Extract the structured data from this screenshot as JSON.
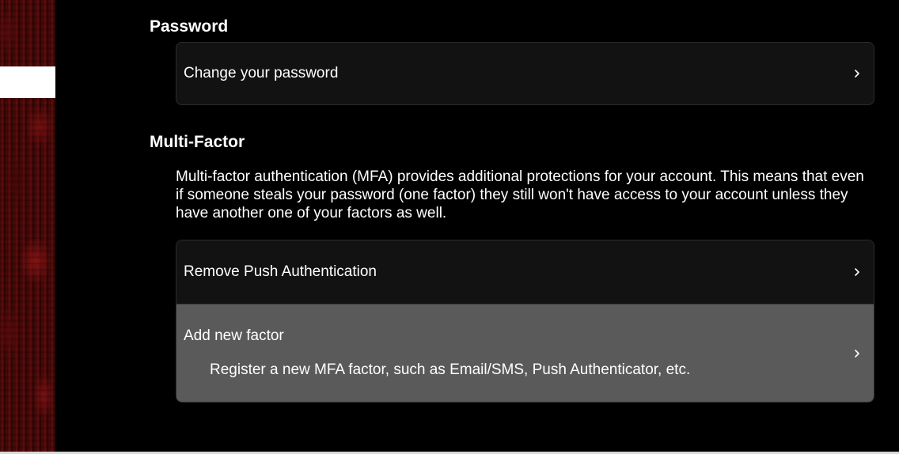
{
  "password_section": {
    "heading": "Password",
    "change_password_label": "Change your password"
  },
  "mfa_section": {
    "heading": "Multi-Factor",
    "description": "Multi-factor authentication (MFA) provides additional protections for your account. This means that even if someone steals your password (one factor) they still won't have access to your account unless they have another one of your factors as well.",
    "items": [
      {
        "label": "Remove Push Authentication",
        "description": ""
      },
      {
        "label": "Add new factor",
        "description": "Register a new MFA factor, such as Email/SMS, Push Authenticator, etc."
      }
    ]
  },
  "icons": {
    "chevron": "chevron-right-icon"
  },
  "colors": {
    "background": "#000000",
    "card": "#121212",
    "card_highlighted": "#5a5a5a",
    "side_image_red": "#6a0e0e"
  }
}
